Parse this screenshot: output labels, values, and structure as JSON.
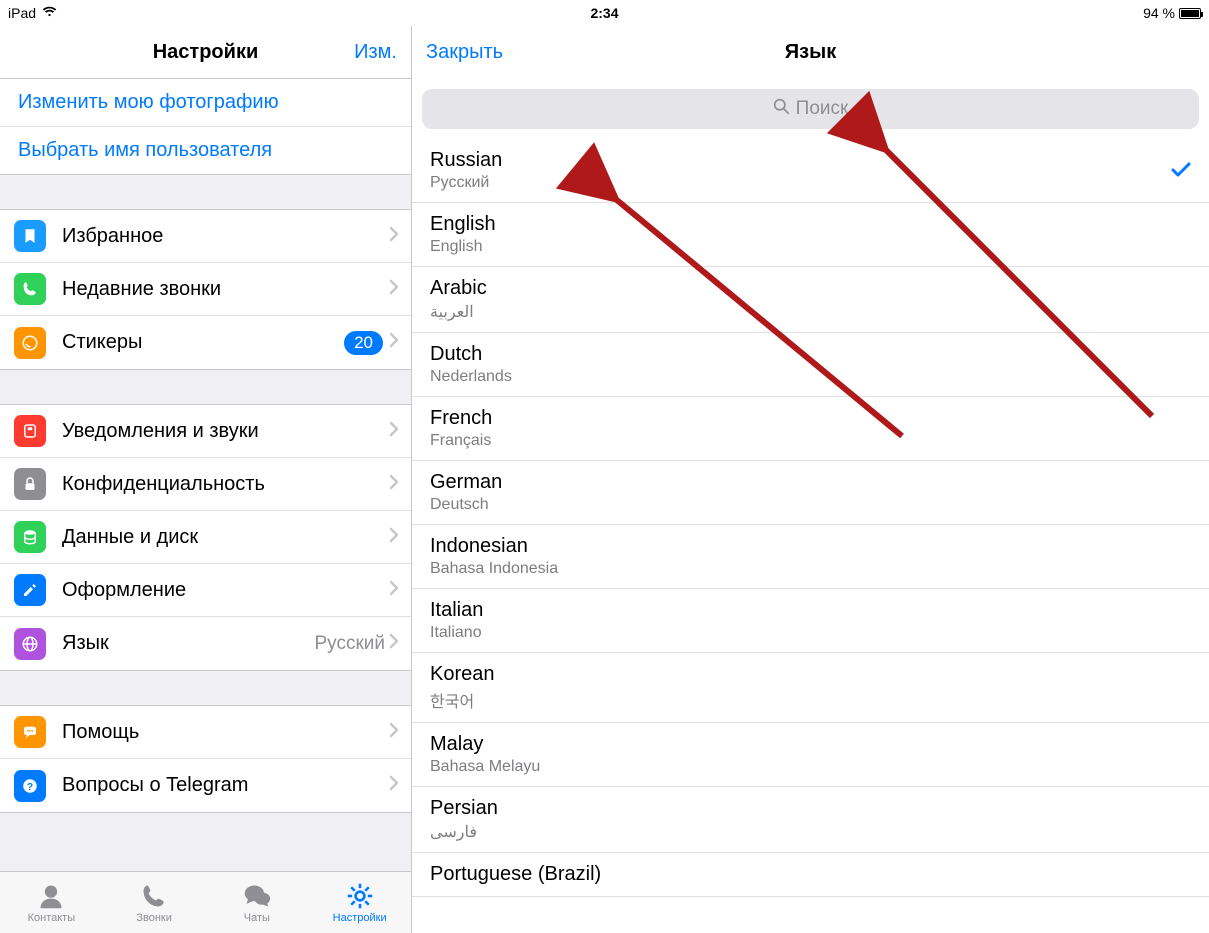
{
  "status": {
    "device": "iPad",
    "time": "2:34",
    "battery": "94 %"
  },
  "left": {
    "title": "Настройки",
    "edit": "Изм.",
    "links": {
      "change_photo": "Изменить мою фотографию",
      "choose_username": "Выбрать имя пользователя"
    },
    "group1": [
      {
        "label": "Избранное",
        "icon": "bookmark",
        "bg": "#1a9cff"
      },
      {
        "label": "Недавние звонки",
        "icon": "phone",
        "bg": "#30d158"
      },
      {
        "label": "Стикеры",
        "icon": "sticker",
        "bg": "#ff9500",
        "badge": "20"
      }
    ],
    "group2": [
      {
        "label": "Уведомления и звуки",
        "icon": "notif",
        "bg": "#ff3b30"
      },
      {
        "label": "Конфиденциальность",
        "icon": "lock",
        "bg": "#8e8e93"
      },
      {
        "label": "Данные и диск",
        "icon": "data",
        "bg": "#30d158"
      },
      {
        "label": "Оформление",
        "icon": "brush",
        "bg": "#007aff"
      },
      {
        "label": "Язык",
        "icon": "globe",
        "bg": "#af52de",
        "value": "Русский"
      }
    ],
    "group3": [
      {
        "label": "Помощь",
        "icon": "chat",
        "bg": "#ff9500"
      },
      {
        "label": "Вопросы о Telegram",
        "icon": "help",
        "bg": "#007aff"
      }
    ],
    "tabs": {
      "contacts": "Контакты",
      "calls": "Звонки",
      "chats": "Чаты",
      "settings": "Настройки"
    }
  },
  "right": {
    "close": "Закрыть",
    "title": "Язык",
    "search_placeholder": "Поиск",
    "languages": [
      {
        "name": "Russian",
        "native": "Русский",
        "selected": true
      },
      {
        "name": "English",
        "native": "English"
      },
      {
        "name": "Arabic",
        "native": "العربية"
      },
      {
        "name": "Dutch",
        "native": "Nederlands"
      },
      {
        "name": "French",
        "native": "Français"
      },
      {
        "name": "German",
        "native": "Deutsch"
      },
      {
        "name": "Indonesian",
        "native": "Bahasa Indonesia"
      },
      {
        "name": "Italian",
        "native": "Italiano"
      },
      {
        "name": "Korean",
        "native": "한국어"
      },
      {
        "name": "Malay",
        "native": "Bahasa Melayu"
      },
      {
        "name": "Persian",
        "native": "فارسی"
      },
      {
        "name": "Portuguese (Brazil)",
        "native": ""
      }
    ]
  }
}
